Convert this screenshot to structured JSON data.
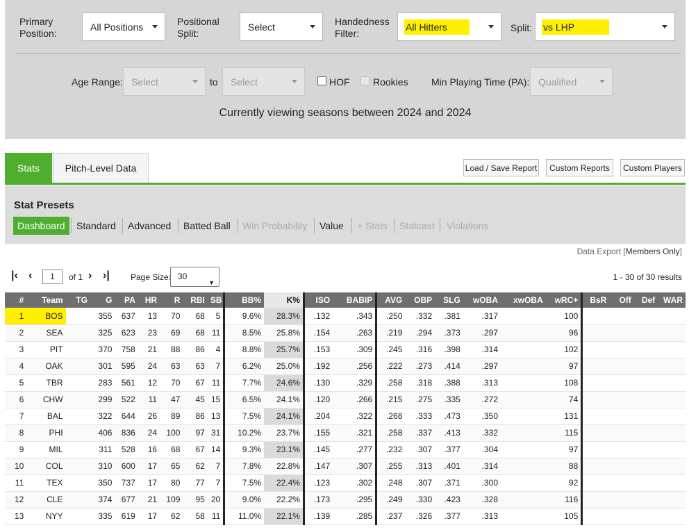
{
  "filters": {
    "primary_position_label": "Primary Position:",
    "primary_position_value": "All Positions",
    "positional_split_label": "Positional Split:",
    "positional_split_value": "Select",
    "handedness_label": "Handedness Filter:",
    "handedness_value": "All Hitters",
    "split_label": "Split:",
    "split_value": "vs LHP",
    "age_range_label": "Age Range:",
    "age_from": "Select",
    "to_label": "to",
    "age_to": "Select",
    "hof_label": "HOF",
    "rookies_label": "Rookies",
    "min_pt_label": "Min Playing Time (PA):",
    "min_pt_value": "Qualified",
    "viewing_text": "Currently viewing seasons between 2024 and 2024"
  },
  "tabs": [
    "Stats",
    "Pitch-Level Data"
  ],
  "toolbar": {
    "load_save": "Load / Save Report",
    "custom_reports": "Custom Reports",
    "custom_players": "Custom Players"
  },
  "presets": {
    "title": "Stat Presets",
    "items": [
      "Dashboard",
      "Standard",
      "Advanced",
      "Batted Ball",
      "Win Probability",
      "Value",
      "+ Stats",
      "Statcast",
      "Violations"
    ]
  },
  "export": {
    "prefix": "Data Export [",
    "members": "Members Only",
    "suffix": "]"
  },
  "pager": {
    "first": "|<",
    "prev": "<",
    "page": "1",
    "of": "of 1",
    "next": ">",
    "last": ">|",
    "page_size_label": "Page Size:",
    "page_size": "30",
    "results": "1 - 30 of 30 results"
  },
  "table": {
    "columns": [
      "#",
      "Team",
      "TG",
      "G",
      "PA",
      "HR",
      "R",
      "RBI",
      "SB",
      "BB%",
      "K%",
      "ISO",
      "BABIP",
      "AVG",
      "OBP",
      "SLG",
      "wOBA",
      "xwOBA",
      "wRC+",
      "BsR",
      "Off",
      "Def",
      "WAR"
    ],
    "rows": [
      [
        "1",
        "BOS",
        "",
        "355",
        "637",
        "13",
        "70",
        "68",
        "5",
        "9.6%",
        "28.3%",
        ".132",
        ".343",
        ".250",
        ".332",
        ".381",
        ".317",
        "",
        "100",
        "",
        "",
        "",
        ""
      ],
      [
        "2",
        "SEA",
        "",
        "325",
        "623",
        "23",
        "69",
        "68",
        "11",
        "8.5%",
        "25.8%",
        ".154",
        ".263",
        ".219",
        ".294",
        ".373",
        ".297",
        "",
        "96",
        "",
        "",
        "",
        ""
      ],
      [
        "3",
        "PIT",
        "",
        "370",
        "758",
        "21",
        "88",
        "86",
        "4",
        "8.8%",
        "25.7%",
        ".153",
        ".309",
        ".245",
        ".316",
        ".398",
        ".314",
        "",
        "102",
        "",
        "",
        "",
        ""
      ],
      [
        "4",
        "OAK",
        "",
        "301",
        "595",
        "24",
        "63",
        "63",
        "7",
        "6.2%",
        "25.0%",
        ".192",
        ".256",
        ".222",
        ".273",
        ".414",
        ".297",
        "",
        "97",
        "",
        "",
        "",
        ""
      ],
      [
        "5",
        "TBR",
        "",
        "283",
        "561",
        "12",
        "70",
        "67",
        "11",
        "7.7%",
        "24.6%",
        ".130",
        ".329",
        ".258",
        ".318",
        ".388",
        ".313",
        "",
        "108",
        "",
        "",
        "",
        ""
      ],
      [
        "6",
        "CHW",
        "",
        "299",
        "522",
        "11",
        "47",
        "45",
        "15",
        "6.5%",
        "24.1%",
        ".120",
        ".266",
        ".215",
        ".275",
        ".335",
        ".272",
        "",
        "74",
        "",
        "",
        "",
        ""
      ],
      [
        "7",
        "BAL",
        "",
        "322",
        "644",
        "26",
        "89",
        "86",
        "13",
        "7.5%",
        "24.1%",
        ".204",
        ".322",
        ".268",
        ".333",
        ".473",
        ".350",
        "",
        "131",
        "",
        "",
        "",
        ""
      ],
      [
        "8",
        "PHI",
        "",
        "406",
        "836",
        "24",
        "100",
        "97",
        "31",
        "10.2%",
        "23.7%",
        ".155",
        ".321",
        ".258",
        ".337",
        ".413",
        ".332",
        "",
        "115",
        "",
        "",
        "",
        ""
      ],
      [
        "9",
        "MIL",
        "",
        "311",
        "528",
        "16",
        "68",
        "67",
        "14",
        "9.3%",
        "23.1%",
        ".145",
        ".277",
        ".232",
        ".307",
        ".377",
        ".304",
        "",
        "97",
        "",
        "",
        "",
        ""
      ],
      [
        "10",
        "COL",
        "",
        "310",
        "600",
        "17",
        "65",
        "62",
        "7",
        "7.8%",
        "22.8%",
        ".147",
        ".307",
        ".255",
        ".313",
        ".401",
        ".314",
        "",
        "88",
        "",
        "",
        "",
        ""
      ],
      [
        "11",
        "TEX",
        "",
        "350",
        "737",
        "17",
        "80",
        "77",
        "7",
        "7.5%",
        "22.4%",
        ".123",
        ".302",
        ".248",
        ".307",
        ".371",
        ".300",
        "",
        "92",
        "",
        "",
        "",
        ""
      ],
      [
        "12",
        "CLE",
        "",
        "374",
        "677",
        "21",
        "109",
        "95",
        "20",
        "9.0%",
        "22.2%",
        ".173",
        ".295",
        ".249",
        ".330",
        ".423",
        ".328",
        "",
        "116",
        "",
        "",
        "",
        ""
      ],
      [
        "13",
        "NYY",
        "",
        "335",
        "619",
        "17",
        "62",
        "58",
        "11",
        "11.0%",
        "22.1%",
        ".139",
        ".285",
        ".237",
        ".326",
        ".377",
        ".313",
        "",
        "105",
        "",
        "",
        "",
        ""
      ]
    ]
  },
  "colors": {
    "accent_green": "#50ae2f",
    "highlight_yellow": "#ffef00",
    "header_gray": "#6f6f6f"
  }
}
